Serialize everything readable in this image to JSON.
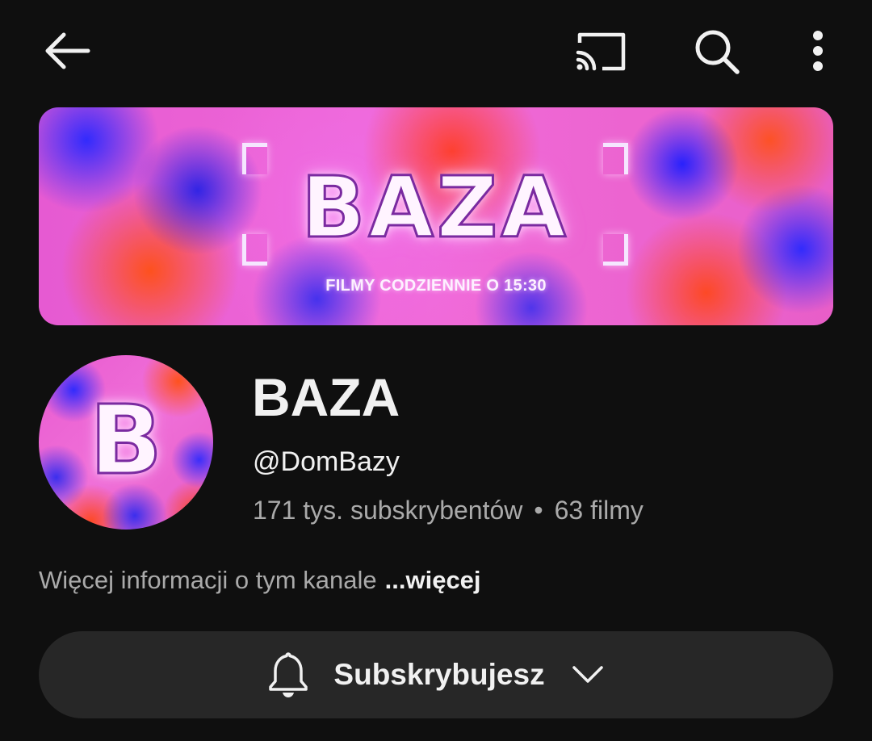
{
  "topbar": {
    "back_icon": "arrow-left-icon",
    "cast_icon": "cast-icon",
    "search_icon": "search-icon",
    "more_icon": "more-vertical-icon"
  },
  "banner": {
    "title": "BAZA",
    "subtitle": "FILMY CODZIENNIE O 15:30"
  },
  "channel": {
    "avatar_letter": "B",
    "name": "BAZA",
    "handle": "@DomBazy",
    "subscribers": "171 tys. subskrybentów",
    "separator": "•",
    "videos": "63 filmy"
  },
  "description": {
    "text": "Więcej informacji o tym kanale",
    "more_label": "...więcej"
  },
  "subscribe": {
    "label": "Subskrybujesz",
    "bell_icon": "bell-icon",
    "chevron_icon": "chevron-down-icon"
  },
  "colors": {
    "background": "#0f0f0f",
    "button_background": "#272727",
    "primary_text": "#f1f1f1",
    "secondary_text": "#aaaaaa",
    "banner_pink": "#e65ad2",
    "banner_blue": "#2828ff",
    "banner_orange": "#ff5014"
  }
}
